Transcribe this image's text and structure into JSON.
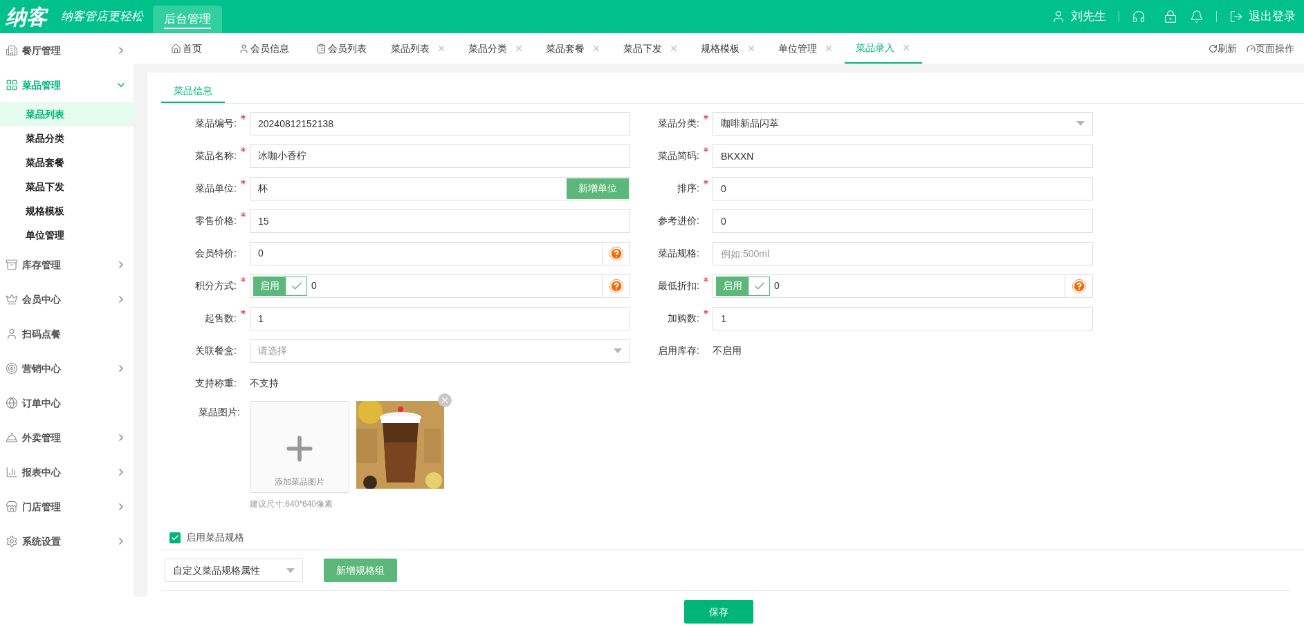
{
  "header": {
    "logo": "纳客",
    "slogan": "纳客管店更轻松",
    "module_tab": {
      "label": "后台管理",
      "selected": true
    },
    "user_name": "刘先生",
    "logout": "退出登录"
  },
  "sidebar": [
    {
      "label": "餐厅管理",
      "expanded": false,
      "selected": false
    },
    {
      "label": "菜品管理",
      "expanded": true,
      "selected": true,
      "children": [
        {
          "label": "菜品列表",
          "selected": true
        },
        {
          "label": "菜品分类",
          "selected": false
        },
        {
          "label": "菜品套餐",
          "selected": false
        },
        {
          "label": "菜品下发",
          "selected": false
        },
        {
          "label": "规格模板",
          "selected": false
        },
        {
          "label": "单位管理",
          "selected": false
        }
      ]
    },
    {
      "label": "库存管理",
      "expanded": false,
      "selected": false
    },
    {
      "label": "会员中心",
      "expanded": false,
      "selected": false
    },
    {
      "label": "扫码点餐",
      "selected": false
    },
    {
      "label": "营销中心",
      "expanded": false,
      "selected": false
    },
    {
      "label": "订单中心",
      "selected": false
    },
    {
      "label": "外卖管理",
      "expanded": false,
      "selected": false
    },
    {
      "label": "报表中心",
      "expanded": false,
      "selected": false
    },
    {
      "label": "门店管理",
      "expanded": false,
      "selected": false
    },
    {
      "label": "系统设置",
      "expanded": false,
      "selected": false
    }
  ],
  "tabs": [
    {
      "label": "首页",
      "closable": false,
      "selected": false
    },
    {
      "label": "会员信息",
      "closable": false,
      "selected": false
    },
    {
      "label": "会员列表",
      "closable": false,
      "selected": false
    },
    {
      "label": "菜品列表",
      "closable": true,
      "selected": false
    },
    {
      "label": "菜品分类",
      "closable": true,
      "selected": false
    },
    {
      "label": "菜品套餐",
      "closable": true,
      "selected": false
    },
    {
      "label": "菜品下发",
      "closable": true,
      "selected": false
    },
    {
      "label": "规格模板",
      "closable": true,
      "selected": false
    },
    {
      "label": "单位管理",
      "closable": true,
      "selected": false
    },
    {
      "label": "菜品录入",
      "closable": true,
      "selected": true
    }
  ],
  "tab_actions": [
    "刷新",
    "页面操作"
  ],
  "form": {
    "tab": {
      "label": "菜品信息",
      "selected": true
    },
    "left": [
      {
        "kind": "input",
        "label": "菜品编号:",
        "required": true,
        "value": "20240812152138"
      },
      {
        "kind": "input",
        "label": "菜品名称:",
        "required": true,
        "value": "冰咖小香柠"
      },
      {
        "kind": "input_button",
        "label": "菜品单位:",
        "required": true,
        "value": "杯",
        "button": "新增单位"
      },
      {
        "kind": "input",
        "label": "零售价格:",
        "required": true,
        "value": "15"
      },
      {
        "kind": "input_help",
        "label": "会员特价:",
        "required": false,
        "value": "0"
      },
      {
        "kind": "toggle",
        "label": "积分方式:",
        "required": true,
        "toggle_label": "启用",
        "checked": true,
        "value": "0"
      },
      {
        "kind": "input",
        "label": "起售数:",
        "required": true,
        "value": "1"
      },
      {
        "kind": "select",
        "label": "关联餐盒:",
        "required": false,
        "placeholder": "请选择"
      },
      {
        "kind": "text",
        "label": "支持称重:",
        "required": false,
        "value": "不支持"
      }
    ],
    "right": [
      {
        "kind": "select",
        "label": "菜品分类:",
        "required": true,
        "value": "咖啡新品闪萃"
      },
      {
        "kind": "input",
        "label": "菜品简码:",
        "required": true,
        "value": "BKXXN"
      },
      {
        "kind": "input",
        "label": "排序:",
        "required": true,
        "value": "0"
      },
      {
        "kind": "input",
        "label": "参考进价:",
        "required": false,
        "value": "0"
      },
      {
        "kind": "input",
        "label": "菜品规格:",
        "required": false,
        "placeholder": "例如:500ml"
      },
      {
        "kind": "toggle",
        "label": "最低折扣:",
        "required": true,
        "toggle_label": "启用",
        "checked": true,
        "value": "0"
      },
      {
        "kind": "input",
        "label": "加购数:",
        "required": true,
        "value": "1"
      },
      {
        "kind": "text",
        "label": "启用库存:",
        "required": false,
        "value": "不启用"
      }
    ],
    "image": {
      "label": "菜品图片:",
      "upload_label": "添加菜品图片",
      "hint": "建议尺寸:640*640像素"
    },
    "spec": {
      "label": "启用菜品规格",
      "checked": true
    },
    "spec_select": {
      "value": "自定义菜品规格属性"
    },
    "add_group_button": "新增规格组"
  },
  "save_button": "保存"
}
